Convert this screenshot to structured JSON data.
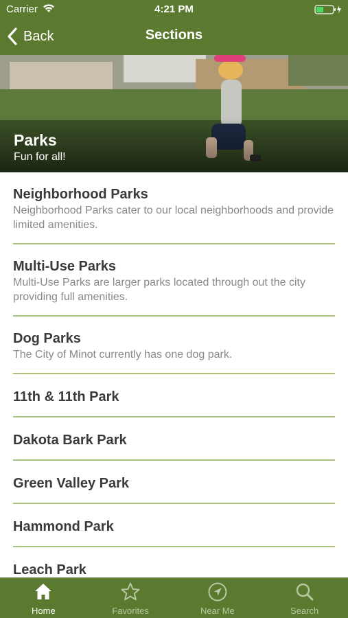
{
  "status_bar": {
    "carrier": "Carrier",
    "time": "4:21 PM",
    "icons": [
      "wifi-icon",
      "battery-icon"
    ]
  },
  "nav": {
    "back_label": "Back",
    "title": "Sections",
    "back_icon": "chevron-left-icon"
  },
  "hero": {
    "title": "Parks",
    "subtitle": "Fun for all!"
  },
  "list": {
    "items": [
      {
        "title": "Neighborhood Parks",
        "description": "Neighborhood Parks cater to our local neighborhoods and provide limited amenities."
      },
      {
        "title": "Multi-Use Parks",
        "description": "Multi-Use Parks are larger parks located through out the city providing full amenities."
      },
      {
        "title": "Dog Parks",
        "description": "The City of Minot currently has one dog park."
      },
      {
        "title": "11th & 11th Park"
      },
      {
        "title": "Dakota Bark Park"
      },
      {
        "title": "Green Valley Park"
      },
      {
        "title": "Hammond Park"
      },
      {
        "title": "Leach Park"
      }
    ]
  },
  "tabbar": {
    "tabs": [
      {
        "label": "Home",
        "icon": "home-icon",
        "active": true
      },
      {
        "label": "Favorites",
        "icon": "star-icon",
        "active": false
      },
      {
        "label": "Near Me",
        "icon": "location-arrow-icon",
        "active": false
      },
      {
        "label": "Search",
        "icon": "search-icon",
        "active": false
      }
    ]
  },
  "colors": {
    "brand_green": "#5b7a2f",
    "divider_green": "#a9c07e",
    "title_text": "#3a3a3a",
    "desc_text": "#888888",
    "battery_fill": "#4cd964"
  }
}
